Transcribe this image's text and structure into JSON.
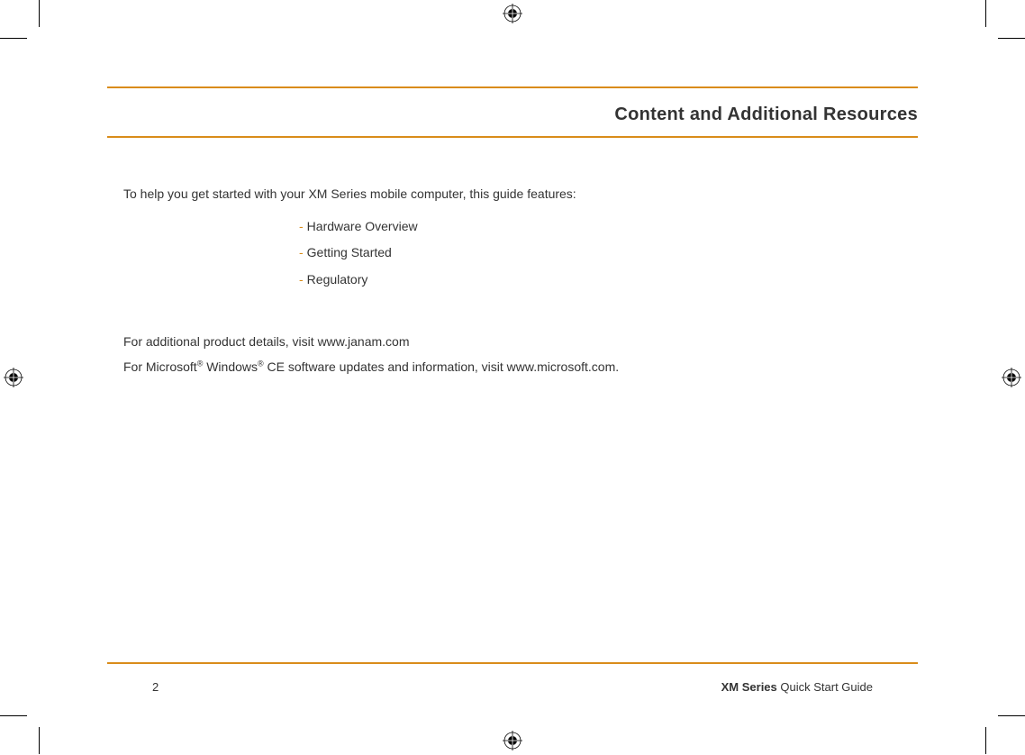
{
  "header": {
    "title": "Content and Additional Resources"
  },
  "body": {
    "intro": "To help you get started with your XM Series mobile computer, this guide features:",
    "features": [
      "Hardware Overview",
      "Getting Started",
      "Regulatory"
    ],
    "additional1_prefix": "For additional product details, visit ",
    "additional1_link": "www.janam.com",
    "additional2_prefix": "For Microsoft",
    "additional2_mid": " Windows",
    "additional2_suffix": " CE software updates and information, visit www.microsoft.com.",
    "reg_mark": "®"
  },
  "footer": {
    "page_number": "2",
    "doc_series": "XM Series",
    "doc_title_rest": " Quick Start Guide"
  },
  "colors": {
    "accent": "#d98c1a"
  }
}
